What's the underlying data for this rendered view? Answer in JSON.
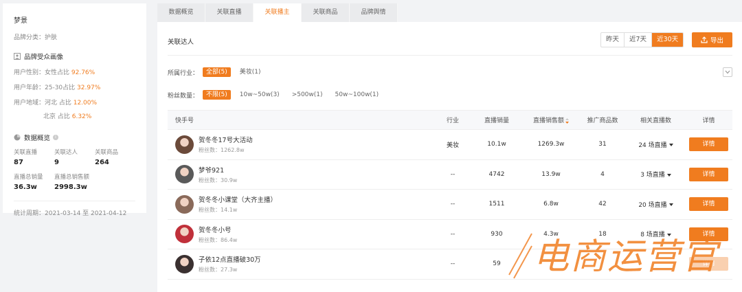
{
  "brand": {
    "name": "梦景",
    "category_line": "品牌分类：护肤"
  },
  "audience": {
    "title": "品牌受众画像",
    "gender": {
      "label": "用户性别：女性占比 ",
      "value": "92.76%"
    },
    "age": {
      "label": "用户年龄：25-30占比 ",
      "value": "32.97%"
    },
    "region1": {
      "label": "用户地域：河北 占比 ",
      "value": "12.00%"
    },
    "region2": {
      "label": "北京 占比 ",
      "value": "6.32%"
    }
  },
  "overview": {
    "title": "数据概览",
    "stats": [
      {
        "label": "关联直播",
        "value": "87"
      },
      {
        "label": "关联达人",
        "value": "9"
      },
      {
        "label": "关联商品",
        "value": "264"
      },
      {
        "label": "直播总销量",
        "value": "36.3w"
      },
      {
        "label": "直播总销售额",
        "value": "2998.3w"
      }
    ],
    "period": "统计周期：2021-03-14 至 2021-04-12"
  },
  "tabs": [
    "数据概览",
    "关联直播",
    "关联播主",
    "关联商品",
    "品牌舆情"
  ],
  "active_tab": 2,
  "section_title": "关联达人",
  "date_ranges": [
    "昨天",
    "近7天",
    "近30天"
  ],
  "export_label": "导出",
  "filters": {
    "industry": {
      "label": "所属行业：",
      "options": [
        "全部(5)",
        "美妆(1)"
      ]
    },
    "fans": {
      "label": "粉丝数量：",
      "options": [
        "不限(5)",
        "10w~50w(3)",
        ">500w(1)",
        "50w~100w(1)"
      ]
    }
  },
  "table": {
    "headers": [
      "快手号",
      "行业",
      "直播销量",
      "直播销售额",
      "推广商品数",
      "相关直播数",
      "详情"
    ],
    "rows": [
      {
        "name": "贺冬冬17号大活动",
        "fans": "粉丝数：1262.8w",
        "industry": "美妆",
        "sales": "10.1w",
        "revenue": "1269.3w",
        "products": "31",
        "lives": "24 场直播",
        "detail": "详情",
        "avatar": "#6b4a3a"
      },
      {
        "name": "梦爷921",
        "fans": "粉丝数：30.9w",
        "industry": "--",
        "sales": "4742",
        "revenue": "13.9w",
        "products": "4",
        "lives": "3 场直播",
        "detail": "详情",
        "avatar": "#5a5a5a"
      },
      {
        "name": "贺冬冬小课堂（大齐主播）",
        "fans": "粉丝数：14.1w",
        "industry": "--",
        "sales": "1511",
        "revenue": "6.8w",
        "products": "42",
        "lives": "20 场直播",
        "detail": "详情",
        "avatar": "#8a6a5a"
      },
      {
        "name": "贺冬冬小号",
        "fans": "粉丝数：86.4w",
        "industry": "--",
        "sales": "930",
        "revenue": "4.3w",
        "products": "18",
        "lives": "8 场直播",
        "detail": "详情",
        "avatar": "#c0303a"
      },
      {
        "name": "子依12点直播破30万",
        "fans": "粉丝数：27.3w",
        "industry": "--",
        "sales": "59",
        "revenue": "",
        "products": "",
        "lives": "",
        "detail": "详情",
        "avatar": "#3a3030"
      }
    ]
  },
  "watermark": "电商运营官",
  "colors": {
    "accent": "#f07c1f"
  }
}
